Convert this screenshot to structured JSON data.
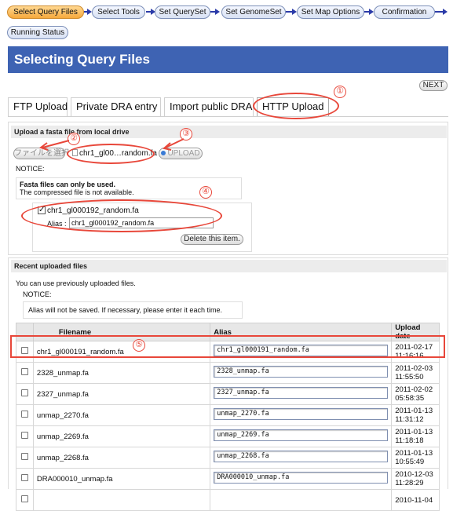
{
  "workflow": {
    "steps": [
      {
        "label": "Select Query Files"
      },
      {
        "label": "Select Tools"
      },
      {
        "label": "Set QuerySet"
      },
      {
        "label": "Set GenomeSet"
      },
      {
        "label": "Set Map Options"
      },
      {
        "label": "Confirmation"
      },
      {
        "label": "Running Status"
      }
    ]
  },
  "page": {
    "title": "Selecting Query Files",
    "next_label": "NEXT"
  },
  "tabs": [
    {
      "label": "FTP Upload"
    },
    {
      "label": "Private DRA entry"
    },
    {
      "label": "Import public DRA"
    },
    {
      "label": "HTTP Upload"
    }
  ],
  "upload": {
    "section_title": "Upload a fasta file from local drive",
    "choose_file_label": "ファイルを選択",
    "chosen_file": "chr1_gl00…random.fa",
    "upload_label": "UPLOAD",
    "notice_label": "NOTICE:",
    "notice_bold": "Fasta files can only be used.",
    "notice_text": "The compressed file is not available.",
    "item_filename": "chr1_gl000192_random.fa",
    "alias_label": "Alias :",
    "alias_value": "chr1_gl000192_random.fa",
    "delete_label": "Delete this item."
  },
  "recent": {
    "section_title": "Recent uploaded files",
    "intro": "You can use previously uploaded files.",
    "notice_label": "NOTICE:",
    "notice_text": "Alias will not be saved. If necessary, please enter it each time.",
    "headers": {
      "filename": "Filename",
      "alias": "Alias",
      "date": "Upload date"
    },
    "rows": [
      {
        "filename": "chr1_gl000191_random.fa",
        "alias": "chr1_gl000191_random.fa",
        "date1": "2011-02-17",
        "date2": "11:16:16"
      },
      {
        "filename": "2328_unmap.fa",
        "alias": "2328_unmap.fa",
        "date1": "2011-02-03",
        "date2": "11:55:50"
      },
      {
        "filename": "2327_unmap.fa",
        "alias": "2327_unmap.fa",
        "date1": "2011-02-02",
        "date2": "05:58:35"
      },
      {
        "filename": "unmap_2270.fa",
        "alias": "unmap_2270.fa",
        "date1": "2011-01-13",
        "date2": "11:31:12"
      },
      {
        "filename": "unmap_2269.fa",
        "alias": "unmap_2269.fa",
        "date1": "2011-01-13",
        "date2": "11:18:18"
      },
      {
        "filename": "unmap_2268.fa",
        "alias": "unmap_2268.fa",
        "date1": "2011-01-13",
        "date2": "10:55:49"
      },
      {
        "filename": "DRA000010_unmap.fa",
        "alias": "DRA000010_unmap.fa",
        "date1": "2010-12-03",
        "date2": "11:28:29"
      },
      {
        "filename": "",
        "alias": "",
        "date1": "2010-11-04",
        "date2": ""
      }
    ]
  },
  "annotations": {
    "n1": "①",
    "n2": "②",
    "n3": "③",
    "n4": "④",
    "n5": "⑤"
  },
  "colors": {
    "accent": "#3e63b3",
    "highlight": "#e8473a",
    "active_step": "#f6a93c"
  }
}
